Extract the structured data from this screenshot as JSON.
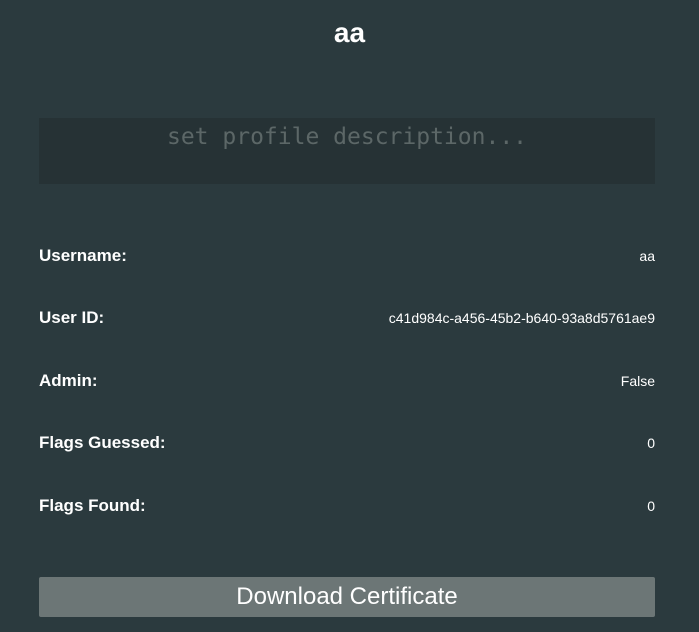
{
  "profile": {
    "name": "aa",
    "description": {
      "value": "",
      "placeholder": "set profile description..."
    }
  },
  "details": [
    {
      "label": "Username:",
      "value": "aa"
    },
    {
      "label": "User ID:",
      "value": "c41d984c-a456-45b2-b640-93a8d5761ae9"
    },
    {
      "label": "Admin:",
      "value": "False"
    },
    {
      "label": "Flags Guessed:",
      "value": "0"
    },
    {
      "label": "Flags Found:",
      "value": "0"
    }
  ],
  "actions": {
    "download_label": "Download Certificate"
  },
  "colors": {
    "background": "#2b3a3e",
    "input_background": "#263235",
    "placeholder": "#5c6767",
    "button": "#6c7676",
    "text": "#ffffff"
  }
}
